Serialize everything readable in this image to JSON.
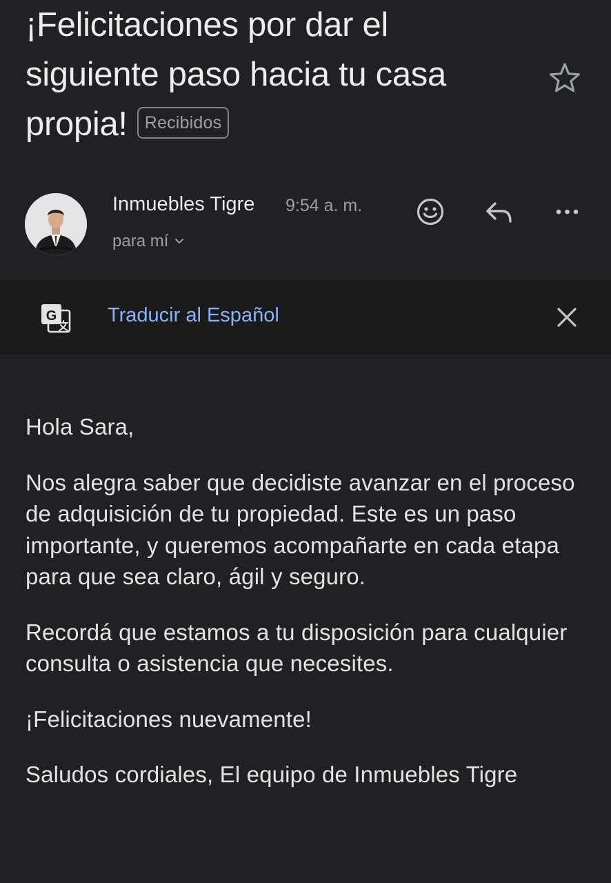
{
  "email": {
    "subject": "¡Felicitaciones por dar el siguiente paso hacia tu casa propia!",
    "label": "Recibidos",
    "sender_name": "Inmuebles Tigre",
    "time": "9:54 a. m.",
    "recipient": "para mí"
  },
  "translate_bar": {
    "link_label": "Traducir al Español"
  },
  "body": {
    "greeting": "Hola Sara,",
    "paragraph1": "Nos alegra saber que decidiste avanzar en el proceso de adquisición de tu propiedad. Este es un paso importante, y queremos acompañarte en cada etapa para que sea claro, ágil y seguro.",
    "paragraph2": "Recordá que estamos a tu disposición para cualquier consulta o asistencia que necesites.",
    "paragraph3": "¡Felicitaciones nuevamente!",
    "closing": "Saludos cordiales, El equipo de Inmuebles Tigre"
  },
  "icons": {
    "star": "star-outline-icon",
    "emoji": "emoji-smile-icon",
    "reply": "reply-icon",
    "more": "more-horizontal-icon",
    "translate": "google-translate-icon",
    "close": "close-icon",
    "expand": "chevron-down-icon"
  },
  "colors": {
    "background": "#202124",
    "translate_bar": "#1b1b1c",
    "link": "#8ab4f8",
    "secondary_text": "#9aa0a6"
  }
}
